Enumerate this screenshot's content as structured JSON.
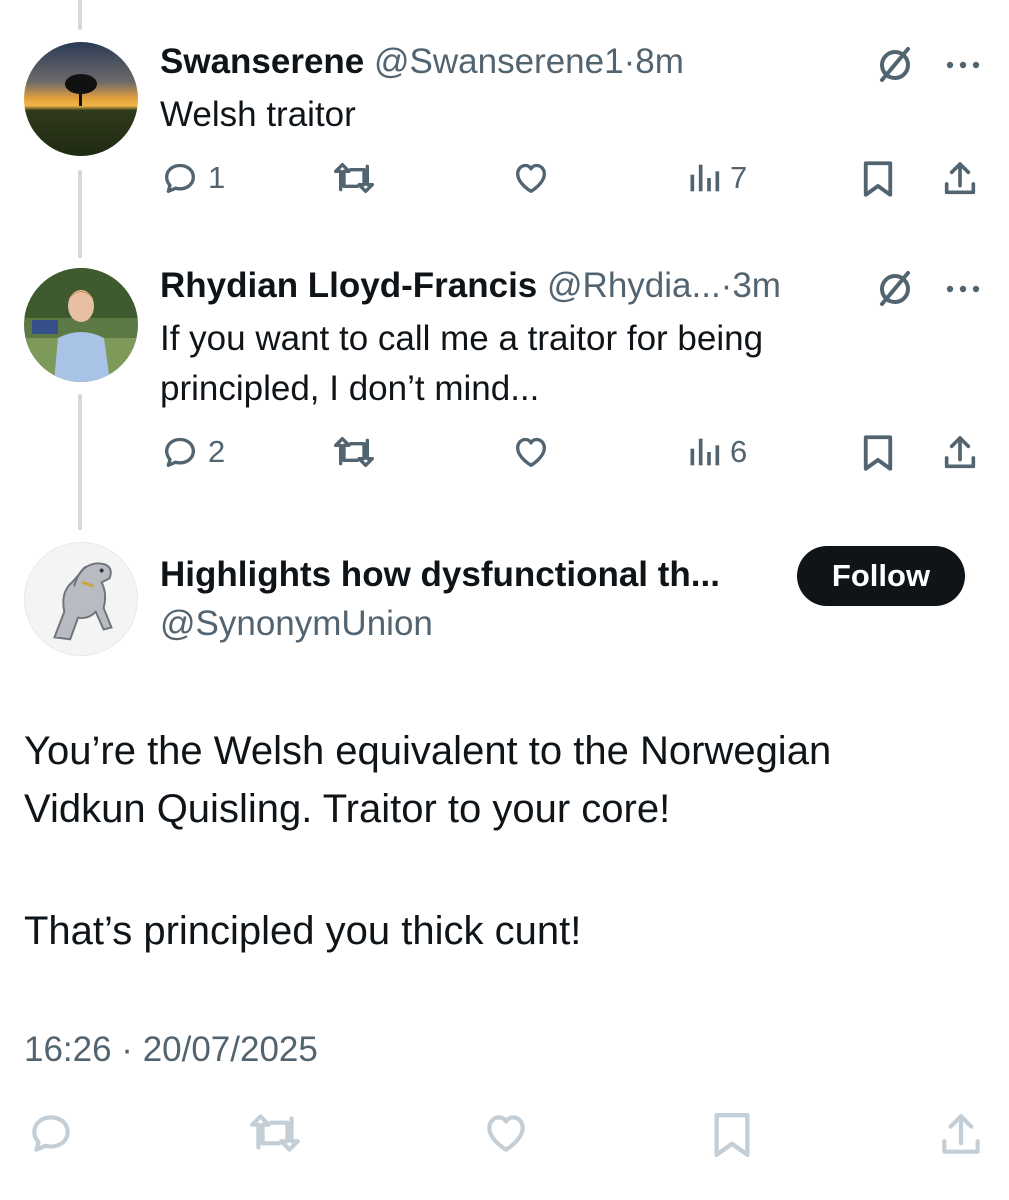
{
  "replies": [
    {
      "name": "Swanserene",
      "handle": "@Swanserene1",
      "dot": "·",
      "time": "8m",
      "text": "Welsh traitor",
      "replies_count": "1",
      "views_count": "7",
      "avatar_icon": "tree-sunset-avatar"
    },
    {
      "name": "Rhydian Lloyd-Francis",
      "handle": "@Rhydia...",
      "dot": "·",
      "time": "3m",
      "text_line1": "If you want to call me a traitor for being",
      "text_line2": "principled, I don’t mind...",
      "replies_count": "2",
      "views_count": "6",
      "avatar_icon": "person-photo-avatar"
    }
  ],
  "main": {
    "name": "Highlights how dysfunctional th...",
    "handle": "@SynonymUnion",
    "follow_label": "Follow",
    "line1": "You’re the Welsh equivalent to the Norwegian",
    "line2": "Vidkun Quisling.  Traitor to your core!",
    "line3": "That’s principled you thick cunt!",
    "timestamp": "16:26 · 20/07/2025",
    "avatar_icon": "silver-horse-avatar"
  },
  "colors": {
    "text": "#0f1419",
    "muted": "#536471",
    "thread_line": "#cfd9de",
    "follow_bg": "#0f1419"
  },
  "icons": [
    "reply-icon",
    "repost-icon",
    "like-icon",
    "views-icon",
    "bookmark-icon",
    "share-icon",
    "grok-icon",
    "more-icon"
  ]
}
